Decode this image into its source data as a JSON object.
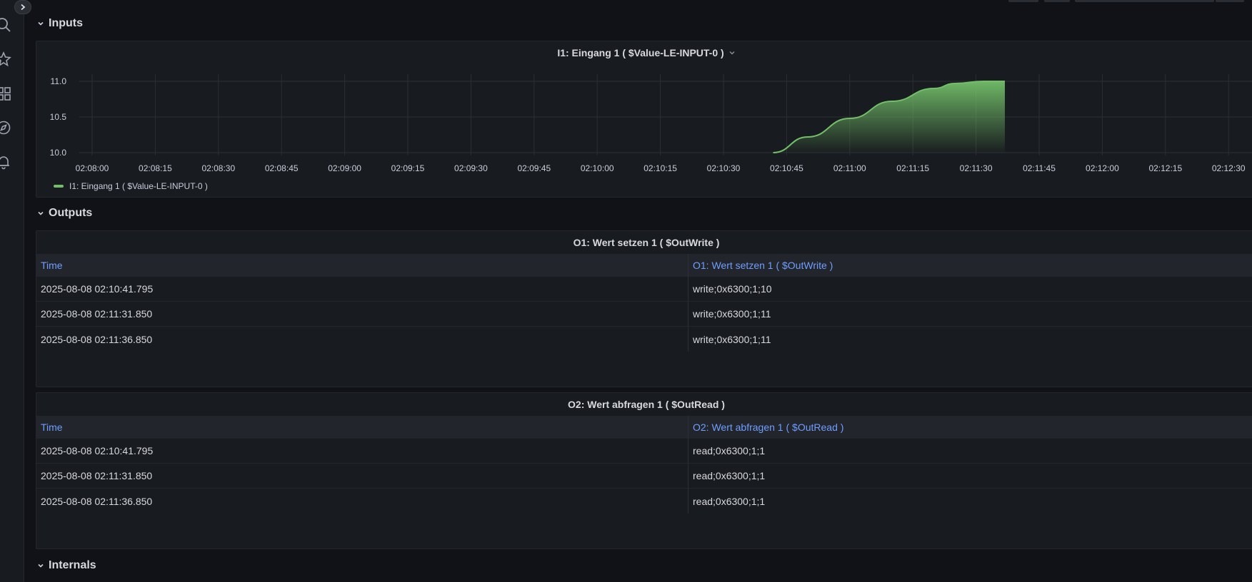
{
  "sections": {
    "inputs": "Inputs",
    "outputs": "Outputs",
    "internals": "Internals"
  },
  "input_panel": {
    "title": "I1: Eingang 1 ( $Value-LE-INPUT-0 )",
    "legend": "I1: Eingang 1 ( $Value-LE-INPUT-0 )"
  },
  "chart_data": {
    "type": "area",
    "series": [
      {
        "name": "I1: Eingang 1 ( $Value-LE-INPUT-0 )",
        "color": "#73bf69",
        "x": [
          "02:10:41.795",
          "02:10:50",
          "02:11:00",
          "02:11:10",
          "02:11:20",
          "02:11:25",
          "02:11:31.850",
          "02:11:36.850"
        ],
        "y": [
          10.0,
          10.22,
          10.48,
          10.72,
          10.9,
          10.97,
          11.0,
          11.0
        ]
      }
    ],
    "x_ticks": [
      "02:08:00",
      "02:08:15",
      "02:08:30",
      "02:08:45",
      "02:09:00",
      "02:09:15",
      "02:09:30",
      "02:09:45",
      "02:10:00",
      "02:10:15",
      "02:10:30",
      "02:10:45",
      "02:11:00",
      "02:11:15",
      "02:11:30",
      "02:11:45",
      "02:12:00",
      "02:12:15",
      "02:12:30"
    ],
    "y_ticks": [
      "10.0",
      "10.5",
      "11.0"
    ],
    "ylim": [
      10.0,
      11.0
    ],
    "grid": true,
    "legend_position": "bottom-left"
  },
  "output_tables": [
    {
      "title": "O1: Wert setzen 1 ( $OutWrite )",
      "columns": [
        "Time",
        "O1: Wert setzen 1 ( $OutWrite )"
      ],
      "rows": [
        [
          "2025-08-08 02:10:41.795",
          "write;0x6300;1;10"
        ],
        [
          "2025-08-08 02:11:31.850",
          "write;0x6300;1;11"
        ],
        [
          "2025-08-08 02:11:36.850",
          "write;0x6300;1;11"
        ]
      ]
    },
    {
      "title": "O2: Wert abfragen 1 ( $OutRead )",
      "columns": [
        "Time",
        "O2: Wert abfragen 1 ( $OutRead )"
      ],
      "rows": [
        [
          "2025-08-08 02:10:41.795",
          "read;0x6300;1;1"
        ],
        [
          "2025-08-08 02:11:31.850",
          "read;0x6300;1;1"
        ],
        [
          "2025-08-08 02:11:36.850",
          "read;0x6300;1;1"
        ]
      ]
    }
  ],
  "icons": {
    "expand": "chevron-right-icon",
    "nav": [
      "search-icon",
      "star-icon",
      "dashboards-icon",
      "explore-icon",
      "alert-bell-icon"
    ]
  },
  "colors": {
    "series": "#73bf69",
    "header_link": "#6e9fff",
    "panel_bg": "#181b1f",
    "page_bg": "#111217"
  }
}
